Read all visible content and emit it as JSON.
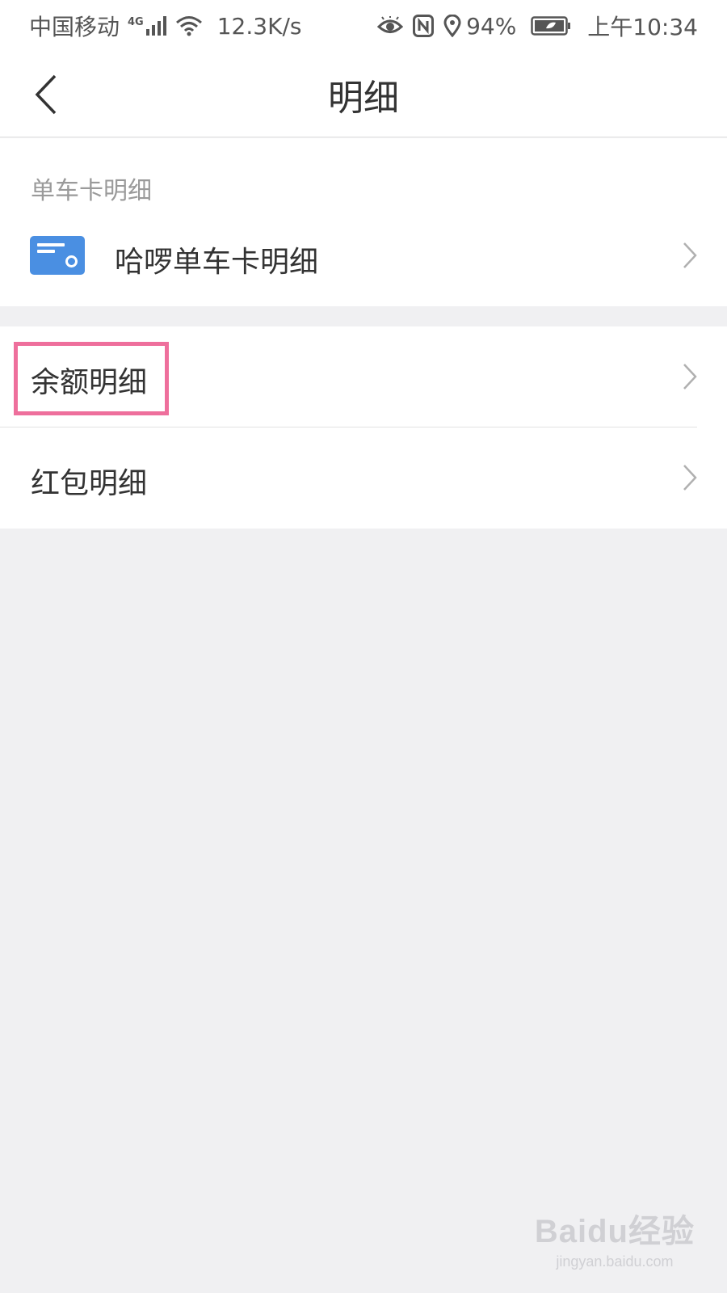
{
  "status_bar": {
    "carrier": "中国移动",
    "network": "4G",
    "speed": "12.3K/s",
    "battery_percent": "94%",
    "time": "上午10:34",
    "icons": [
      "signal-icon",
      "wifi-icon",
      "eye-icon",
      "nfc-icon",
      "location-icon",
      "battery-icon"
    ]
  },
  "nav": {
    "title": "明细",
    "back_icon": "chevron-left-icon"
  },
  "bike_card_section": {
    "label": "单车卡明细",
    "item": {
      "label": "哈啰单车卡明细",
      "icon": "card-icon"
    }
  },
  "detail_list": {
    "items": [
      {
        "label": "余额明细",
        "highlighted": true
      },
      {
        "label": "红包明细",
        "highlighted": false
      }
    ]
  },
  "watermark": {
    "brand": "Baidu经验",
    "url": "jingyan.baidu.com"
  },
  "colors": {
    "accent_blue": "#4a8fe2",
    "highlight_pink": "#ee6f9c",
    "background": "#f0f0f2"
  }
}
